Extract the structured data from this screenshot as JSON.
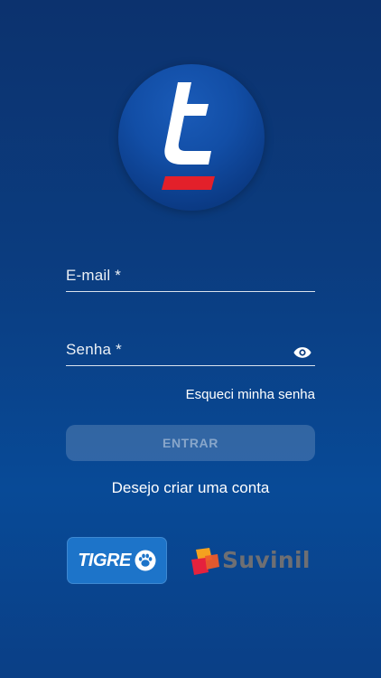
{
  "app": {
    "logo_icon": "t-brand-logo"
  },
  "form": {
    "email_label": "E-mail *",
    "password_label": "Senha *",
    "password_toggle_icon": "eye-icon",
    "forgot_password": "Esqueci minha senha",
    "submit_label": "ENTRAR",
    "create_account": "Desejo criar uma conta"
  },
  "brands": {
    "tigre": "TIGRE",
    "suvinil": "Suvinil"
  },
  "colors": {
    "background_top": "#0c326e",
    "background_bottom": "#0a3f86",
    "logo_stripe": "#e3202a",
    "tigre_blue": "#1d74c9",
    "suvinil_gray": "#6e6f73"
  }
}
